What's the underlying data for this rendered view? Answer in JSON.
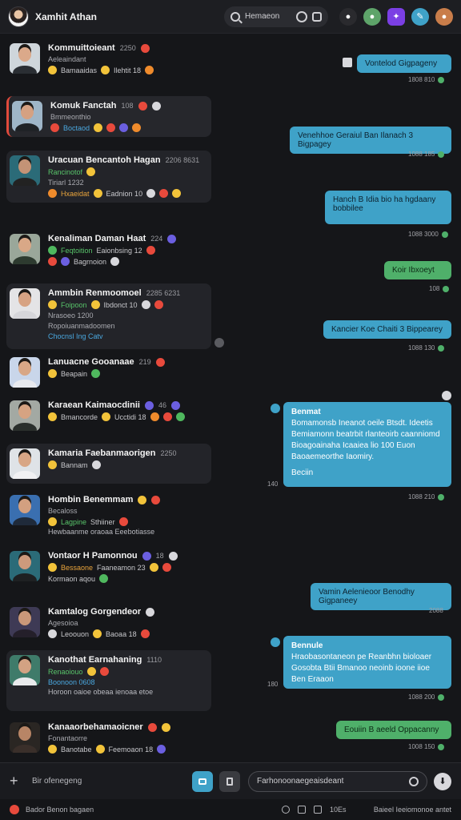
{
  "header": {
    "user_name": "Xamhit Athan",
    "search_text": "Hemaeon",
    "colors": {
      "accent": "#3fa2c8",
      "purple": "#7b3fe4",
      "green": "#4fb06a"
    }
  },
  "chats": [
    {
      "name": "Kommuittoieant",
      "time": "2250",
      "sub": "Aeleaindant",
      "row": [
        "Bamaaidas",
        "Ilehtit 18"
      ]
    },
    {
      "name": "Komuk Fanctah",
      "time": "108",
      "sub": "Bmmeonthio",
      "row": [
        "Boctaod"
      ]
    },
    {
      "name": "Uracuan Bencantoh Hagan",
      "time": "2206 8631",
      "sub": "Rancinotof",
      "extra": "Tiriarl 1232",
      "row": [
        "Hxaeidat",
        "Eadnion 10"
      ]
    },
    {
      "name": "Kenaliman Daman Haat",
      "time": "224",
      "sub": "Feqtoition",
      "row": [
        "Bagrnoion",
        "Eaionbsing 12"
      ]
    },
    {
      "name": "Ammbin Renmoomoel",
      "time": "2285 6231",
      "sub": "Foipoon",
      "extra": "Nrasoeo 1200",
      "extra2": "Ropoiuanmadoomen",
      "link": "Chocnsl Ing Catv",
      "row": [
        "Ibdonct 10"
      ]
    },
    {
      "name": "Lanuacne Gooanaae",
      "time": "219",
      "sub": "Beapain",
      "row": []
    },
    {
      "name": "Karaean Kaimaocdinii",
      "time": "46",
      "sub": "Bmancorde",
      "row": [
        "Ucctidi 18"
      ]
    },
    {
      "name": "Kamaria Faebanmaorigen",
      "time": "2250",
      "sub": "Bannam",
      "row": []
    },
    {
      "name": "Hombin Benemmam",
      "time": "",
      "sub": "Becaloss",
      "row": [
        "Lagpine",
        "Sthiiner"
      ],
      "multi": "Hewbaanme oraoaa Eeebotiasse"
    },
    {
      "name": "Vontaor H Pamonnou",
      "time": "18",
      "sub": "Vencabaen",
      "row": [
        "Bessaone",
        "Faaneamon 23"
      ],
      "extra": "Kormaon aqou"
    },
    {
      "name": "Kamtalog Gorgendeor",
      "time": "",
      "sub": "Agesoioa",
      "row": [
        "Leoouon",
        "Baoaa 18"
      ]
    },
    {
      "name": "Kanothat Earnahaning",
      "time": "1110",
      "sub": "Renaoiouo",
      "row": [
        "Boonoon 0608"
      ],
      "multi": "Horoon oaioe obeaa ienoaa etoe"
    },
    {
      "name": "Kanaaorbehamaoicner",
      "time": "",
      "sub": "Fonantaorre",
      "row": [
        "Banotabe",
        "Feemoaon 18"
      ]
    }
  ],
  "messages": [
    {
      "text": "Vontelod Gigpageny",
      "meta": "1808 810"
    },
    {
      "text": "Venehhoe Geraiul Ban Ilanach 3 Bigpagey",
      "meta": "1088 185"
    },
    {
      "text": "Hanch B Idia bio ha hgdaany bobbilee",
      "meta": "1088 3000"
    },
    {
      "text": "Koir Ibxoeyt",
      "meta": "108"
    },
    {
      "text": "Kancier Koe Chaiti 3 Bippearey",
      "meta": "1088 130"
    },
    {
      "title": "Benmat",
      "text": "Bomamonsb Ineanot oeile Btsdt. Ideetis Bemiamonn beatrbit rlanteoirb caanniomd Bioagoainaha Icaaiea lio 100 Euon Baoaemeorthe Iaomiry.",
      "tail": "Beciin",
      "meta": "1088 210"
    },
    {
      "text": "Vamin Aelenieoor Benodhy Gigpaneey",
      "meta": "2088"
    },
    {
      "title": "Bennule",
      "text": "Hraobasontaneon pe Reanbhn bioloaer Gosobta Btii Bmanoo neoinb ioone iioe Ben Eraaon",
      "meta": "1088 200"
    },
    {
      "text": "Eouiin B aeeld Oppacanny",
      "meta": "1008 150"
    }
  ],
  "composer": {
    "label": "Bir ofenegeng",
    "placeholder": "Farhonoonaegeaisdeant"
  },
  "footer": {
    "left": "Bador Benon bagaen",
    "mid": "10Es",
    "right": "Baieel Ieeiomonoe antet"
  }
}
